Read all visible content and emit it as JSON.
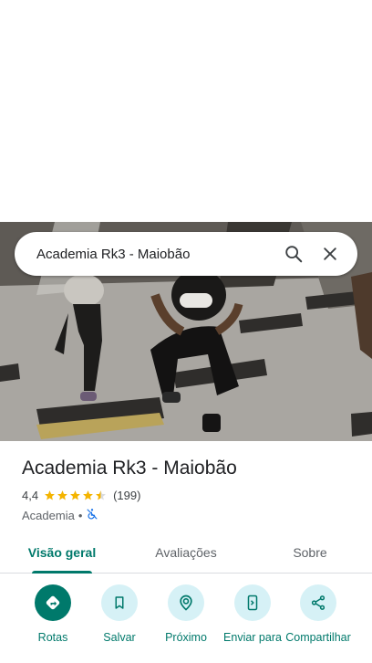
{
  "search": {
    "query": "Academia Rk3 - Maiobão"
  },
  "place": {
    "name": "Academia Rk3 - Maiobão",
    "rating": "4,4",
    "rating_value": 4.4,
    "review_count": "(199)",
    "category": "Academia",
    "separator": "•"
  },
  "tabs": [
    {
      "label": "Visão geral",
      "active": true
    },
    {
      "label": "Avaliações",
      "active": false
    },
    {
      "label": "Sobre",
      "active": false
    }
  ],
  "actions": [
    {
      "label": "Rotas",
      "icon": "directions-icon"
    },
    {
      "label": "Salvar",
      "icon": "bookmark-icon"
    },
    {
      "label": "Próximo",
      "icon": "nearby-icon"
    },
    {
      "label": "Enviar para o telefone",
      "icon": "send-to-phone-icon"
    },
    {
      "label": "Compartilhar",
      "icon": "share-icon"
    }
  ],
  "colors": {
    "accent": "#00796b",
    "action_bg": "#d6f1f6",
    "star": "#f4b400",
    "wheelchair_no": "#1a73e8"
  }
}
